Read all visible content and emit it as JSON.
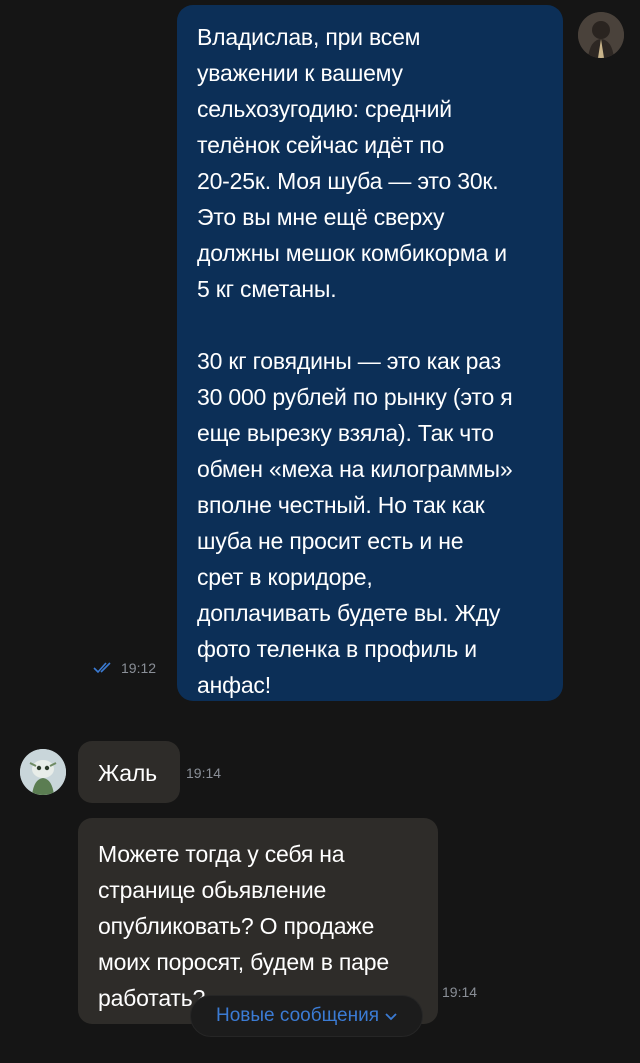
{
  "messages": {
    "outgoing": {
      "text": "Владислав, при всем\nуважении к вашему\nсельхозугодию: средний\nтелёнок сейчас идёт по\n20-25к. Моя шуба — это 30к.\nЭто вы мне ещё сверху\nдолжны мешок комбикорма и\n5 кг сметаны.\n\n30 кг говядины — это как раз\n30 000 рублей по рынку (это я\nеще вырезку взяла). Так что\nобмен «меха на килограммы»\nвполне честный. Но так как\nшуба не просит есть и не\nсрет в коридоре,\nдоплачивать будете вы. Жду\nфото теленка в профиль и\nанфас!",
      "time": "19:12",
      "status_icon": "double-check-icon"
    },
    "incoming": [
      {
        "text": "Жаль",
        "time": "19:14"
      },
      {
        "text": "Можете тогда у себя на\nстранице обьявление\nопубликовать? О продаже\nмоих поросят, будем в паре\nработать?",
        "time": "19:14"
      }
    ]
  },
  "new_messages": {
    "label": "Новые сообщения",
    "icon": "chevron-down-icon"
  },
  "colors": {
    "background": "#151515",
    "outgoing_bubble": "#0c2f57",
    "incoming_bubble": "#2e2c29",
    "accent": "#3b7bd4",
    "meta": "#8a8f97"
  }
}
